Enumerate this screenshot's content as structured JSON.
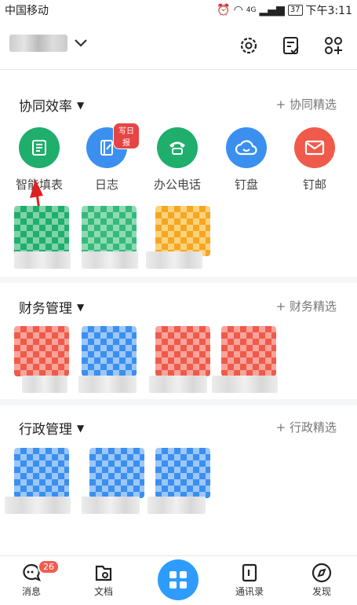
{
  "status": {
    "carrier": "中国移动",
    "network": "4G",
    "battery": "37",
    "time": "下午3:11"
  },
  "header": {
    "settings_icon": "gear-icon",
    "todo_icon": "checklist-icon",
    "apps_icon": "apps-add-icon"
  },
  "sections": [
    {
      "title": "协同效率",
      "link": "+ 协同精选",
      "apps": [
        {
          "label": "智能填表",
          "icon": "form-icon",
          "color": "#1fae6c"
        },
        {
          "label": "日志",
          "icon": "journal-icon",
          "color": "#3b8fef",
          "badge": "写日报"
        },
        {
          "label": "办公电话",
          "icon": "phone-icon",
          "color": "#1fae6c"
        },
        {
          "label": "钉盘",
          "icon": "cloud-icon",
          "color": "#3b8fef"
        },
        {
          "label": "钉邮",
          "icon": "mail-icon",
          "color": "#f05a4a"
        }
      ]
    },
    {
      "title": "财务管理",
      "link": "+ 财务精选"
    },
    {
      "title": "行政管理",
      "link": "+ 行政精选"
    }
  ],
  "tabbar": {
    "items": [
      {
        "label": "消息",
        "icon": "message-icon",
        "badge": "26"
      },
      {
        "label": "文档",
        "icon": "document-icon"
      },
      {
        "label": "",
        "icon": "workbench-grid-icon"
      },
      {
        "label": "通讯录",
        "icon": "contacts-icon"
      },
      {
        "label": "发现",
        "icon": "compass-icon"
      }
    ]
  },
  "colors": {
    "green": "#1fae6c",
    "blue": "#3b8fef",
    "red": "#f05a4a",
    "orange": "#f5a623",
    "accent": "#2e9cff"
  }
}
